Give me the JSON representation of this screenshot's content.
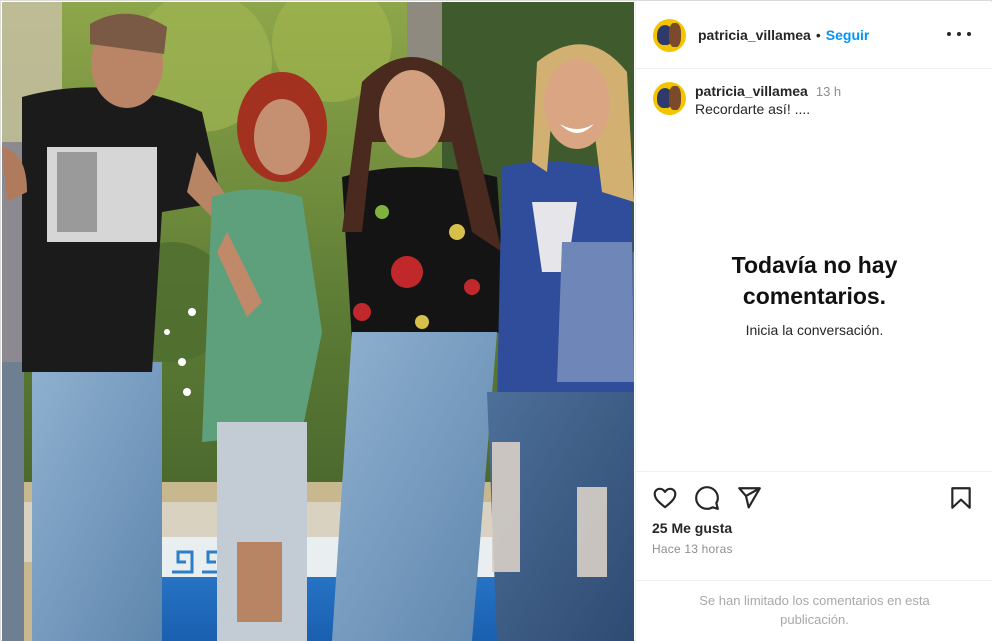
{
  "header": {
    "username": "patricia_villamea",
    "separator": "•",
    "follow_label": "Seguir",
    "more_icon": "more-horizontal-icon"
  },
  "caption": {
    "username": "patricia_villamea",
    "time": "13 h",
    "text": "Recordarte así! ...."
  },
  "comments": {
    "empty_title": "Todavía no hay comentarios.",
    "empty_subtitle": "Inicia la conversación."
  },
  "actions": {
    "like_icon": "heart-icon",
    "comment_icon": "comment-icon",
    "share_icon": "send-icon",
    "save_icon": "bookmark-icon"
  },
  "stats": {
    "likes": "25 Me gusta",
    "posted_ago": "Hace 13 horas"
  },
  "footer": {
    "limited_text": "Se han limitado los comentarios en esta publicación."
  },
  "colors": {
    "link_blue": "#0095f6",
    "muted_gray": "#8e8e8e",
    "border": "#efefef"
  }
}
